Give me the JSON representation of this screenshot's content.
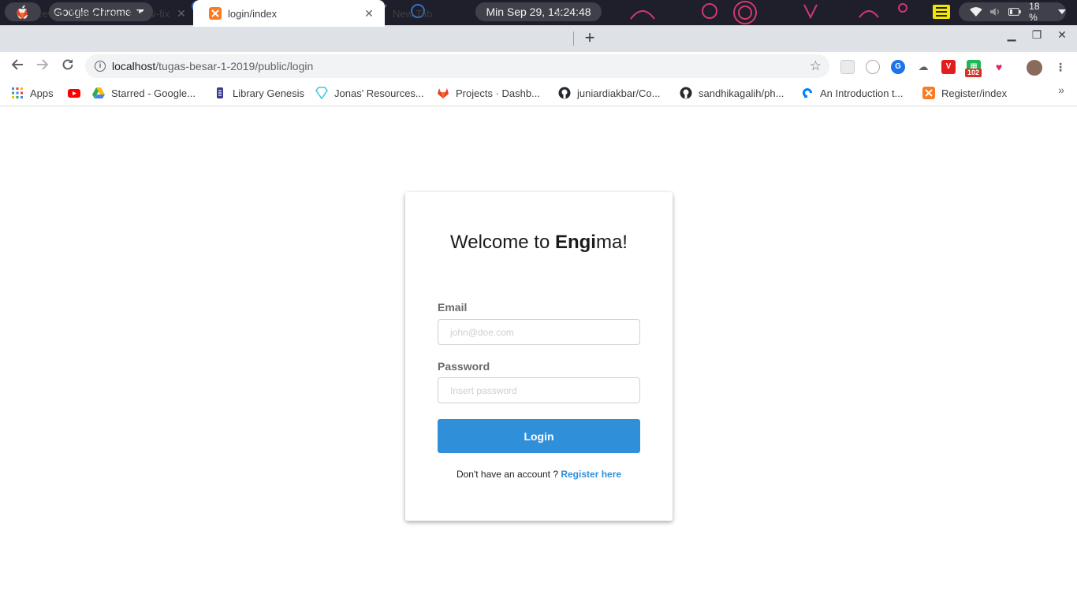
{
  "system_bar": {
    "app_name": "Google Chrome",
    "clock": "Min Sep 29, 14:24:48",
    "battery": "18 %"
  },
  "browser": {
    "tabs": [
      {
        "title": "Revert \"Merge branch 'dev-fix",
        "favicon": "gitlab-icon",
        "active": false
      },
      {
        "title": "login/index",
        "favicon": "xampp-icon",
        "active": true
      },
      {
        "title": "New Tab",
        "favicon": "",
        "active": false
      }
    ],
    "new_tab_label": "+",
    "url_host": "localhost",
    "url_path": "/tugas-besar-1-2019/public/login",
    "extension_badge": "102",
    "bookmarks": [
      {
        "label": "Apps",
        "icon": "apps-grid-icon"
      },
      {
        "label": "",
        "icon": "youtube-icon"
      },
      {
        "label": "Starred - Google...",
        "icon": "google-drive-icon"
      },
      {
        "label": "Library Genesis",
        "icon": "libgen-icon"
      },
      {
        "label": "Jonas' Resources...",
        "icon": "diamond-icon"
      },
      {
        "label": "Projects · Dashb...",
        "icon": "gitlab-icon"
      },
      {
        "label": "juniardiakbar/Co...",
        "icon": "github-icon"
      },
      {
        "label": "sandhikagalih/ph...",
        "icon": "github-icon"
      },
      {
        "label": "An Introduction t...",
        "icon": "digitalocean-icon"
      },
      {
        "label": "Register/index",
        "icon": "xampp-icon"
      }
    ],
    "bookmarks_overflow": "»"
  },
  "login": {
    "welcome_prefix": "Welcome to ",
    "welcome_bold": "Engi",
    "welcome_suffix": "ma!",
    "email_label": "Email",
    "email_placeholder": "john@doe.com",
    "password_label": "Password",
    "password_placeholder": "Insert password",
    "login_button": "Login",
    "register_prompt": "Don't have an account ? ",
    "register_link": "Register here"
  },
  "colors": {
    "accent": "#2f8fd8",
    "tabstrip": "#dee1e6",
    "topbar": "#1f1e2b"
  }
}
